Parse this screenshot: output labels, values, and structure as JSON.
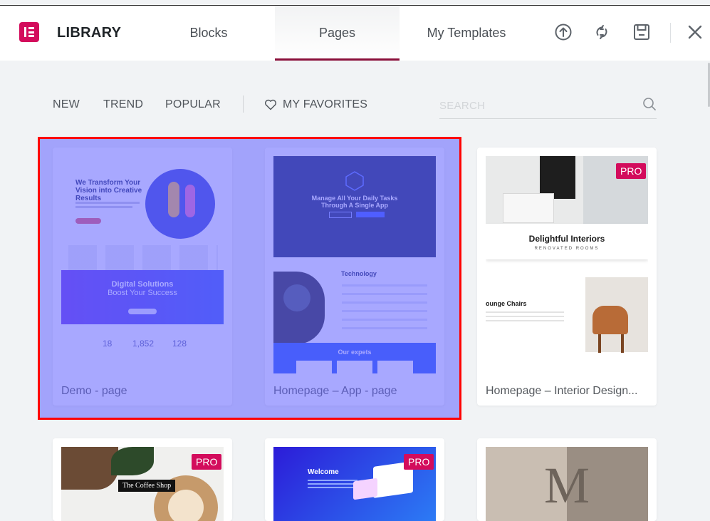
{
  "header": {
    "title": "LIBRARY",
    "tabs": [
      {
        "label": "Blocks",
        "active": false
      },
      {
        "label": "Pages",
        "active": true
      },
      {
        "label": "My Templates",
        "active": false
      }
    ],
    "icons": [
      "upload-icon",
      "sync-icon",
      "save-icon",
      "close-icon"
    ],
    "brand_color": "#d30c5c",
    "active_tab_color": "#8a0f3a"
  },
  "filters": {
    "items": [
      "NEW",
      "TREND",
      "POPULAR"
    ],
    "favorites_label": "MY FAVORITES",
    "search_placeholder": "SEARCH"
  },
  "templates": [
    {
      "title": "Demo - page",
      "pro": false,
      "preview": {
        "headline": "We Transform Your Vision into Creative Results",
        "band_title": "Digital Solutions",
        "band_subtitle": "Boost Your Success",
        "stats": [
          "18",
          "1,852",
          "128"
        ]
      }
    },
    {
      "title": "Homepage – App - page",
      "pro": false,
      "preview": {
        "headline": "Manage All Your Daily Tasks Through A Single App",
        "section": "Technology",
        "footer": "Our expets"
      }
    },
    {
      "title": "Homepage – Interior Design...",
      "pro": true,
      "preview": {
        "headline": "Delightful Interiors",
        "sub": "RENOVATED ROOMS",
        "side": "ounge Chairs"
      }
    },
    {
      "title": "",
      "pro": true,
      "preview": {
        "badge": "The Coffee Shop"
      }
    },
    {
      "title": "",
      "pro": true,
      "preview": {
        "headline": "Welcome"
      }
    },
    {
      "title": "",
      "pro": false,
      "preview": {
        "letter": "M"
      }
    }
  ],
  "pro_label": "PRO",
  "highlight_color": "#ff0000"
}
